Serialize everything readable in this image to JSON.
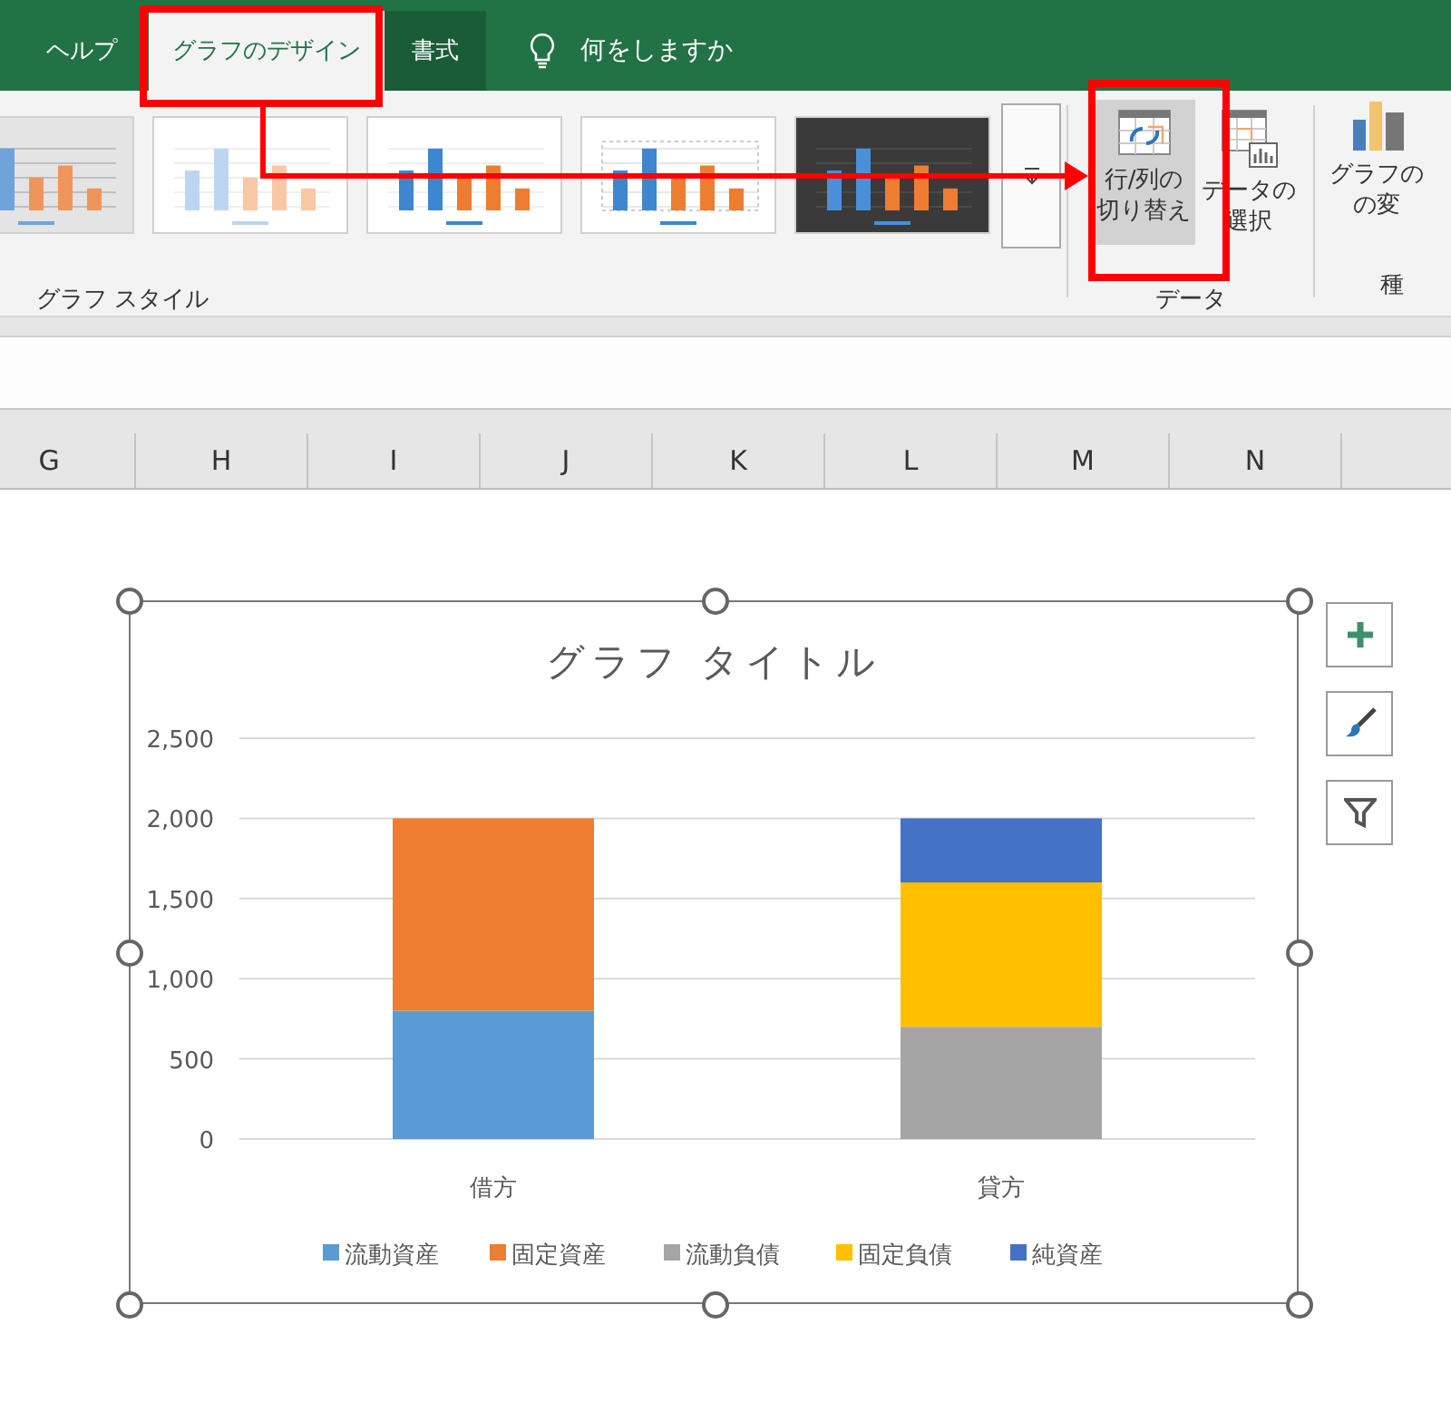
{
  "ribbon_tabs": [
    {
      "label": "ヘルプ",
      "selected": false,
      "highlighted": false
    },
    {
      "label": "グラフのデザイン",
      "selected": true,
      "highlighted": false
    },
    {
      "label": "書式",
      "selected": false,
      "highlighted": true
    }
  ],
  "tell_me": {
    "label": "何をしますか"
  },
  "chart_styles": {
    "thumbnails": [
      {
        "kind": "gradient"
      },
      {
        "kind": "outline"
      },
      {
        "kind": "plain"
      },
      {
        "kind": "hatched"
      },
      {
        "kind": "dark"
      }
    ],
    "label": "グラフ スタイル"
  },
  "data_group": {
    "buttons": [
      {
        "kind": "switch",
        "label_lines": [
          "行/列の",
          "切り替え"
        ],
        "selected": true
      },
      {
        "kind": "select",
        "label_lines": [
          "データの",
          "選択"
        ],
        "selected": false
      }
    ],
    "label": "データ"
  },
  "type_group": {
    "button": {
      "label_lines": [
        "グラフの",
        "の変"
      ]
    },
    "label": "種"
  },
  "columns": [
    "G",
    "H",
    "I",
    "J",
    "K",
    "L",
    "M",
    "N"
  ],
  "chart": {
    "chart_data": {
      "type": "bar",
      "title": "グラフ タイトル",
      "categories": [
        "借方",
        "貸方"
      ],
      "stacked": true,
      "orientation": "vertical",
      "ylim": [
        0,
        2500
      ],
      "grid": true,
      "legend": true,
      "yticks": [
        {
          "value": 0,
          "label": "0"
        },
        {
          "value": 500,
          "label": "500"
        },
        {
          "value": 1000,
          "label": "1,000"
        },
        {
          "value": 1500,
          "label": "1,500"
        },
        {
          "value": 2000,
          "label": "2,000"
        },
        {
          "value": 2500,
          "label": "2,500"
        }
      ],
      "series": [
        {
          "name": "流動資産",
          "color": "#5b9bd5",
          "values": [
            800,
            null
          ]
        },
        {
          "name": "固定資産",
          "color": "#ed7d31",
          "values": [
            1200,
            null
          ]
        },
        {
          "name": "流動負債",
          "color": "#a5a5a5",
          "values": [
            null,
            700
          ]
        },
        {
          "name": "固定負債",
          "color": "#ffc000",
          "values": [
            null,
            900
          ]
        },
        {
          "name": "純資産",
          "color": "#4472c4",
          "values": [
            null,
            400
          ]
        }
      ]
    }
  }
}
